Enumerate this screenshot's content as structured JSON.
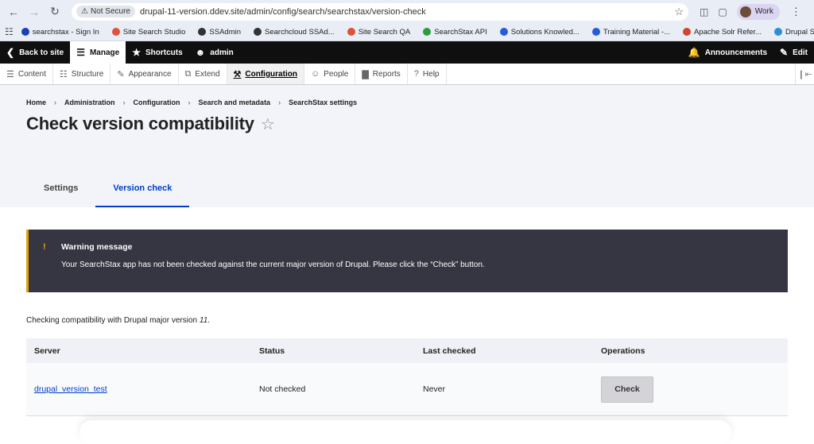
{
  "browser": {
    "secure_label": "Not Secure",
    "url": "drupal-11-version.ddev.site/admin/config/search/searchstax/version-check",
    "profile_label": "Work"
  },
  "bookmarks": [
    {
      "label": "searchstax - Sign In",
      "color": "#1a3fb8"
    },
    {
      "label": "Site Search Studio",
      "color": "#e0513c"
    },
    {
      "label": "SSAdmin",
      "color": "#333333"
    },
    {
      "label": "Searchcloud SSAd...",
      "color": "#333333"
    },
    {
      "label": "Site Search QA",
      "color": "#e0513c"
    },
    {
      "label": "SearchStax API",
      "color": "#2e9b3e"
    },
    {
      "label": "Solutions Knowled...",
      "color": "#2a5bd7"
    },
    {
      "label": "Training Material -...",
      "color": "#2a5bd7"
    },
    {
      "label": "Apache Solr Refer...",
      "color": "#d0452c"
    },
    {
      "label": "Drupal SearchStax...",
      "color": "#2d8ed8"
    }
  ],
  "toolbar": {
    "back_to_site": "Back to site",
    "manage": "Manage",
    "shortcuts": "Shortcuts",
    "user": "admin",
    "announcements": "Announcements",
    "edit": "Edit"
  },
  "tray": [
    {
      "label": "Content",
      "icon": "content-icon"
    },
    {
      "label": "Structure",
      "icon": "structure-icon"
    },
    {
      "label": "Appearance",
      "icon": "appearance-icon"
    },
    {
      "label": "Extend",
      "icon": "extend-icon"
    },
    {
      "label": "Configuration",
      "icon": "wrench-icon"
    },
    {
      "label": "People",
      "icon": "people-icon"
    },
    {
      "label": "Reports",
      "icon": "reports-icon"
    },
    {
      "label": "Help",
      "icon": "help-icon"
    }
  ],
  "breadcrumb": [
    "Home",
    "Administration",
    "Configuration",
    "Search and metadata",
    "SearchStax settings"
  ],
  "page": {
    "title": "Check version compatibility"
  },
  "tabs": [
    {
      "label": "Settings"
    },
    {
      "label": "Version check"
    }
  ],
  "warning": {
    "title": "Warning message",
    "text": "Your SearchStax app has not been checked against the current major version of Drupal. Please click the “Check” button."
  },
  "compat": {
    "prefix": "Checking compatibility with Drupal major version ",
    "version": "11",
    "suffix": "."
  },
  "table": {
    "headers": [
      "Server",
      "Status",
      "Last checked",
      "Operations"
    ],
    "rows": [
      {
        "server": "drupal_version_test",
        "status": "Not checked",
        "last_checked": "Never",
        "operation": "Check"
      }
    ]
  },
  "colors": {
    "accent": "#003ecc",
    "warning_border": "#e0a30e",
    "warning_bg": "#353641",
    "toolbar_bg": "#0f0f0f"
  }
}
